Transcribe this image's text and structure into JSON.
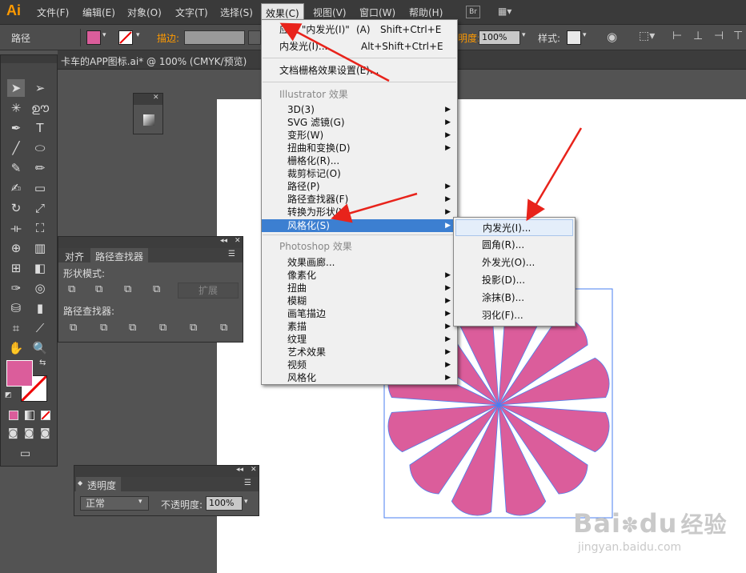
{
  "app": {
    "logo": "Ai",
    "doc_tab": "卡车的APP图标.ai* @ 100% (CMYK/预览)"
  },
  "menubar": [
    "文件(F)",
    "编辑(E)",
    "对象(O)",
    "文字(T)",
    "选择(S)",
    "效果(C)",
    "视图(V)",
    "窗口(W)",
    "帮助(H)"
  ],
  "menubar_br": "Br",
  "options": {
    "label": "路径",
    "stroke_label": "描边:",
    "opacity_label": "明度:",
    "opacity_value": "100%",
    "style_label": "样式:"
  },
  "colors": {
    "accent": "#3c7fd1",
    "fill": "#db5d9b",
    "arrow": "#e8231b",
    "logo": "#ff9a00"
  },
  "effect_menu": {
    "apply_prefix": "应用 \"",
    "apply_name": "内发光(I)\"",
    "apply_key": "(A)",
    "apply_shortcut": "Shift+Ctrl+E",
    "last": "内发光(I)...",
    "last_shortcut": "Alt+Shift+Ctrl+E",
    "raster_settings": "文档栅格效果设置(E)...",
    "illustrator_group": "Illustrator 效果",
    "illustrator_items": [
      "3D(3)",
      "SVG 滤镜(G)",
      "变形(W)",
      "扭曲和变换(D)",
      "栅格化(R)...",
      "裁剪标记(O)",
      "路径(P)",
      "路径查找器(F)",
      "转换为形状(V)",
      "风格化(S)"
    ],
    "photoshop_group": "Photoshop 效果",
    "photoshop_items": [
      "效果画廊...",
      "像素化",
      "扭曲",
      "模糊",
      "画笔描边",
      "素描",
      "纹理",
      "视频",
      "艺术效果",
      "风格化"
    ]
  },
  "stylize_submenu": [
    "内发光(I)...",
    "圆角(R)...",
    "外发光(O)...",
    "投影(D)...",
    "涂抹(B)...",
    "羽化(F)..."
  ],
  "pathfinder": {
    "tab1": "对齐",
    "tab2": "路径查找器",
    "shape_modes": "形状模式:",
    "expand": "扩展",
    "pathfinders": "路径查找器:"
  },
  "transparency": {
    "title": "透明度",
    "mode": "正常",
    "opacity_label": "不透明度:",
    "opacity_value": "100%"
  },
  "watermark": {
    "brand": "Bai",
    "brand2": "du",
    "word": "经验",
    "url": "jingyan.baidu.com"
  }
}
